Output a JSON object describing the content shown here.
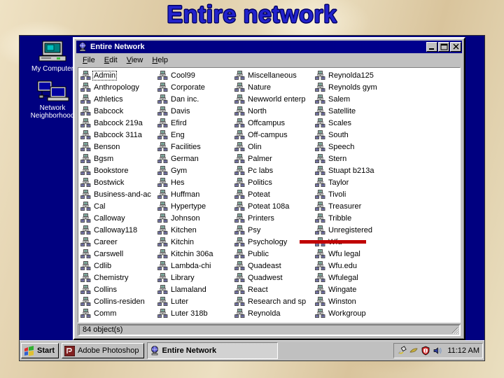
{
  "slide": {
    "title": "Entire network",
    "title_color": "#2222cc",
    "background_color": "#e3d3b0",
    "desktop_color": "#000080"
  },
  "desktop": {
    "icons": [
      {
        "label": "My Computer",
        "icon": "my-computer-icon"
      },
      {
        "label": "Network Neighborhood",
        "icon": "network-neighborhood-icon"
      }
    ]
  },
  "window": {
    "title": "Entire Network",
    "title_icon": "network-globe-icon",
    "controls": [
      {
        "name": "minimize-button",
        "glyph": "_"
      },
      {
        "name": "maximize-button",
        "glyph": "□"
      },
      {
        "name": "close-button",
        "glyph": "×"
      }
    ],
    "menu": [
      {
        "label": "File",
        "accel": "F"
      },
      {
        "label": "Edit",
        "accel": "E"
      },
      {
        "label": "View",
        "accel": "V"
      },
      {
        "label": "Help",
        "accel": "H"
      }
    ],
    "status": "84 object(s)",
    "item_icon": "workgroup-computers-icon",
    "focused_item": "Admin",
    "columns": [
      [
        "Admin",
        "Anthropology",
        "Athletics",
        "Babcock",
        "Babcock 219a",
        "Babcock 311a",
        "Benson",
        "Bgsm",
        "Bookstore",
        "Bostwick",
        "Business-and-ac",
        "Cal",
        "Calloway",
        "Calloway118",
        "Career",
        "Carswell",
        "Cdlib",
        "Chemistry",
        "Collins",
        "Collins-residen",
        "Comm"
      ],
      [
        "Cool99",
        "Corporate",
        "Dan inc.",
        "Davis",
        "Efird",
        "Eng",
        "Facilities",
        "German",
        "Gym",
        "Hes",
        "Huffman",
        "Hypertype",
        "Johnson",
        "Kitchen",
        "Kitchin",
        "Kitchin 306a",
        "Lambda-chi",
        "Library",
        "Llamaland",
        "Luter",
        "Luter 318b"
      ],
      [
        "Miscellaneous",
        "Nature",
        "Newworld enterp",
        "North",
        "Offcampus",
        "Off-campus",
        "Olin",
        "Palmer",
        "Pc labs",
        "Politics",
        "Poteat",
        "Poteat 108a",
        "Printers",
        "Psy",
        "Psychology",
        "Public",
        "Quadeast",
        "Quadwest",
        "React",
        "Research and sp",
        "Reynolda"
      ],
      [
        "Reynolda125",
        "Reynolds gym",
        "Salem",
        "Satellite",
        "Scales",
        "South",
        "Speech",
        "Stern",
        "Stuapt b213a",
        "Taylor",
        "Tivoli",
        "Treasurer",
        "Tribble",
        "Unregistered",
        "Wfu",
        "Wfu legal",
        "Wfu.edu",
        "Wfulegal",
        "Wingate",
        "Winston",
        "Workgroup"
      ]
    ]
  },
  "annotation": {
    "name": "red-highlight-line",
    "color": "#c00000",
    "targets_item": "Wfu"
  },
  "taskbar": {
    "start_label": "Start",
    "start_icon": "windows-flag-icon",
    "tasks": [
      {
        "label": "Adobe Photoshop",
        "icon": "photoshop-icon",
        "active": false
      },
      {
        "label": "Entire Network",
        "icon": "network-globe-icon",
        "active": true
      }
    ],
    "tray_icons": [
      "plug-icon",
      "speaker-mute-icon",
      "antivirus-shield-icon",
      "volume-icon"
    ],
    "clock": "11:12 AM"
  }
}
